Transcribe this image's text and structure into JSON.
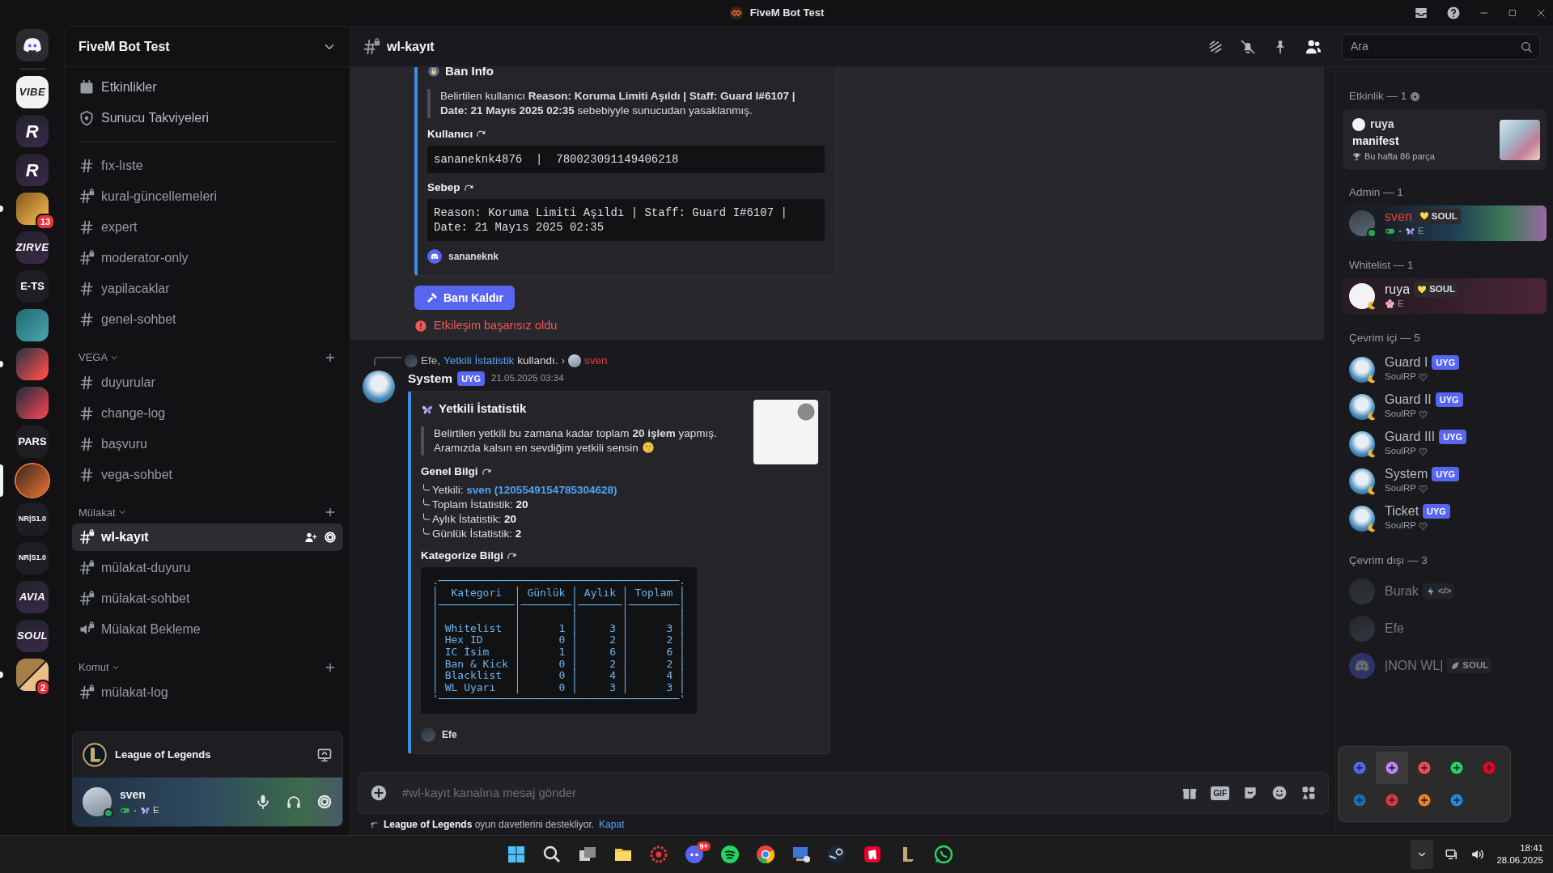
{
  "window": {
    "title": "FiveM Bot Test"
  },
  "servers": [
    {
      "kind": "home",
      "selected": false,
      "unread": false
    },
    {
      "kind": "logo",
      "label": "VIBE",
      "selected": false,
      "unread": false
    },
    {
      "kind": "logo",
      "label": "R",
      "selected": false,
      "unread": false
    },
    {
      "kind": "logo",
      "label": "R",
      "selected": false,
      "unread": false
    },
    {
      "kind": "image",
      "badge": "13",
      "selected": false,
      "unread": true
    },
    {
      "kind": "logo",
      "label": "ZIRVE",
      "selected": false,
      "unread": false
    },
    {
      "kind": "text",
      "label": "E-TS",
      "selected": false,
      "unread": false
    },
    {
      "kind": "image",
      "selected": false,
      "unread": false
    },
    {
      "kind": "image",
      "selected": false,
      "unread": true
    },
    {
      "kind": "image",
      "selected": false,
      "unread": false
    },
    {
      "kind": "text",
      "label": "PARS",
      "selected": false,
      "unread": false
    },
    {
      "kind": "image",
      "selected": true,
      "unread": false
    },
    {
      "kind": "text",
      "label": "NR|S1.0",
      "selected": false,
      "unread": false
    },
    {
      "kind": "text",
      "label": "NR|S1.0",
      "selected": false,
      "unread": false
    },
    {
      "kind": "logo",
      "label": "AVIA",
      "selected": false,
      "unread": false
    },
    {
      "kind": "logo",
      "label": "SOUL",
      "selected": false,
      "unread": false
    },
    {
      "kind": "folder",
      "badge": "2",
      "selected": false,
      "unread": true
    }
  ],
  "sidebar": {
    "server_name": "FiveM Bot Test",
    "shortcuts": [
      {
        "kind": "events",
        "label": "Etkinlikler"
      },
      {
        "kind": "boosts",
        "label": "Sunucu Takviyeleri"
      }
    ],
    "categories": [
      {
        "channels": [
          {
            "name": "fıx-lıste",
            "kind": "text",
            "locked": false,
            "selected": false
          },
          {
            "name": "kural-güncellemeleri",
            "kind": "text",
            "locked": true,
            "selected": false
          },
          {
            "name": "expert",
            "kind": "text",
            "locked": false,
            "selected": false
          },
          {
            "name": "moderator-only",
            "kind": "text",
            "locked": true,
            "selected": false
          },
          {
            "name": "yapilacaklar",
            "kind": "text",
            "locked": false,
            "selected": false
          },
          {
            "name": "genel-sohbet",
            "kind": "text",
            "locked": false,
            "selected": false
          }
        ]
      },
      {
        "title": "VEGA",
        "channels": [
          {
            "name": "duyurular",
            "kind": "text",
            "locked": false,
            "selected": false
          },
          {
            "name": "change-log",
            "kind": "text",
            "locked": false,
            "selected": false
          },
          {
            "name": "başvuru",
            "kind": "text",
            "locked": false,
            "selected": false
          },
          {
            "name": "vega-sohbet",
            "kind": "text",
            "locked": false,
            "selected": false
          }
        ]
      },
      {
        "title": "Mülakat",
        "channels": [
          {
            "name": "wl-kayıt",
            "kind": "text",
            "locked": true,
            "selected": true
          },
          {
            "name": "mülakat-duyuru",
            "kind": "text",
            "locked": true,
            "selected": false
          },
          {
            "name": "mülakat-sohbet",
            "kind": "text",
            "locked": true,
            "selected": false
          },
          {
            "name": "Mülakat Bekleme",
            "kind": "voice",
            "locked": true,
            "selected": false
          }
        ]
      },
      {
        "title": "Komut",
        "channels": [
          {
            "name": "mülakat-log",
            "kind": "text",
            "locked": true,
            "selected": false
          }
        ]
      }
    ],
    "activity": {
      "game": "League of Legends"
    },
    "user": {
      "name": "sven",
      "online": true,
      "subtitle": "E"
    }
  },
  "header": {
    "channel": "wl-kayıt",
    "locked": true,
    "search_placeholder": "Ara"
  },
  "messages": [
    {
      "kind": "ban_report",
      "hovered": true,
      "embed": {
        "title": "Ban Info",
        "description": [
          "Belirtilen kullanıcı **Reason: Koruma Limiti Aşıldı | Staff: Guard I#6107 | Date: 21 Mayıs 2025 02:35** sebebiyyle sunucudan yasaklanmış."
        ],
        "description_emoji": false,
        "thumbnail": false,
        "fields": [
          {
            "name": "Kullanıcı",
            "code": "sananeknk4876  |  780023091149406218",
            "table": false
          },
          {
            "name": "Sebep",
            "code": "Reason: Koruma Limiti Aşıldı | Staff: Guard I#6107 | Date: 21 Mayıs 2025 02:35",
            "table": false
          }
        ],
        "footer": "sananeknk"
      },
      "button": "Banı Kaldır",
      "error": "Etkileşim başarısız oldu"
    },
    {
      "kind": "stats_report",
      "interaction": {
        "user": "Efe,",
        "command": "Yetkili İstatistik",
        "verb": "kullandı.",
        "separator": "›",
        "target": "sven"
      },
      "author": "System",
      "author_badge": "UYG",
      "time": "21.05.2025 03:34",
      "embed": {
        "title": "Yetkili İstatistik",
        "description": [
          "Belirtilen yetkili bu zamana kadar toplam **20 işlem** yapmış.",
          "Aramızda kalsın en sevdiğim yetkili sensin"
        ],
        "description_emoji": true,
        "thumbnail": true,
        "fields": [
          {
            "name": "Genel Bilgi",
            "lines": [
              {
                "label": "Yetkili:",
                "value": "sven (1205549154785304628)",
                "link": true
              },
              {
                "label": "Toplam İstatistik:",
                "value": "20",
                "link": false
              },
              {
                "label": "Aylık İstatistik:",
                "value": "20",
                "link": false
              },
              {
                "label": "Günlük İstatistik:",
                "value": "2",
                "link": false
              }
            ]
          },
          {
            "name": "Kategorize Bilgi",
            "code": ".──────────────────────────────────────.\n│  Kategori  │ Günlük │ Aylık │ Toplam │\n│────────────│────────│───────│────────│\n│            │        │       │        │\n│ Whitelist  │      1 │     3 │      3 │\n│ Hex ID     │      0 │     2 │      2 │\n│ IC İsim    │      1 │     6 │      6 │\n│ Ban & Kick │      0 │     2 │      2 │\n│ Blacklist  │      0 │     4 │      4 │\n│ WL Uyarı   │      0 │     3 │      3 │\n'──────────────────────────────────────'",
            "table": true
          }
        ],
        "footer": "Efe"
      }
    }
  ],
  "composer": {
    "placeholder": "#wl-kayıt kanalına mesaj gönder",
    "gif_label": "GIF"
  },
  "notice": {
    "text": "**League of Legends** oyun davetlerini destekliyor.",
    "action": "Kapat"
  },
  "members": {
    "activity_title": "Etkinlik — 1",
    "activity_card": {
      "user": "ruya",
      "title": "manifest",
      "subtitle": "Bu hafta 86 parça"
    },
    "groups": [
      {
        "title": "Admin — 1",
        "members": [
          {
            "name": "sven",
            "color": "#e8413c",
            "tag": "SOUL",
            "kind": "online",
            "subtitle": "E"
          }
        ]
      },
      {
        "title": "Whitelist — 1",
        "members": [
          {
            "name": "ruya",
            "color": "#e3e5e8",
            "tag": "SOUL",
            "kind": "idle",
            "subtitle": "E"
          }
        ]
      },
      {
        "title": "Çevrim içi — 5",
        "members": [
          {
            "name": "Guard I",
            "color": "#b5bac1",
            "badge": "UYG",
            "kind": "idle",
            "subtitle": "SoulRP",
            "suffix_icon": true
          },
          {
            "name": "Guard II",
            "color": "#b5bac1",
            "badge": "UYG",
            "kind": "idle",
            "subtitle": "SoulRP",
            "suffix_icon": true
          },
          {
            "name": "Guard III",
            "color": "#b5bac1",
            "badge": "UYG",
            "kind": "idle",
            "subtitle": "SoulRP",
            "suffix_icon": true
          },
          {
            "name": "System",
            "color": "#b5bac1",
            "badge": "UYG",
            "kind": "idle",
            "subtitle": "SoulRP",
            "suffix_icon": true
          },
          {
            "name": "Ticket",
            "color": "#b5bac1",
            "badge": "UYG",
            "kind": "idle",
            "subtitle": "SoulRP",
            "suffix_icon": true
          }
        ]
      },
      {
        "title": "Çevrim dışı — 3",
        "members": [
          {
            "name": "Burak",
            "color": "#74767e",
            "tag": "</>",
            "kind": "offline"
          },
          {
            "name": "Efe",
            "color": "#74767e",
            "kind": "offline"
          },
          {
            "name": "|NON WL|",
            "color": "#74767e",
            "tag": "SOUL",
            "kind": "offline"
          }
        ]
      }
    ]
  },
  "tray_popup": {
    "icons": [
      {
        "kind": "discord",
        "selected": false
      },
      {
        "kind": "feather",
        "selected": true
      },
      {
        "kind": "valorant",
        "selected": false
      },
      {
        "kind": "spotify",
        "selected": false
      },
      {
        "kind": "riot",
        "selected": false
      },
      {
        "kind": "steam",
        "selected": false
      },
      {
        "kind": "gear",
        "selected": false
      },
      {
        "kind": "cloud",
        "selected": false
      },
      {
        "kind": "shield",
        "selected": false
      }
    ]
  },
  "taskbar": {
    "apps": [
      {
        "kind": "start"
      },
      {
        "kind": "search"
      },
      {
        "kind": "taskview"
      },
      {
        "kind": "folder"
      },
      {
        "kind": "red-gear"
      },
      {
        "kind": "discord",
        "badge": "9+"
      },
      {
        "kind": "spotify"
      },
      {
        "kind": "chrome"
      },
      {
        "kind": "monitor"
      },
      {
        "kind": "steam"
      },
      {
        "kind": "riot"
      },
      {
        "kind": "league"
      },
      {
        "kind": "whatsapp"
      }
    ],
    "time": "18:41",
    "date": "28.06.2025"
  }
}
